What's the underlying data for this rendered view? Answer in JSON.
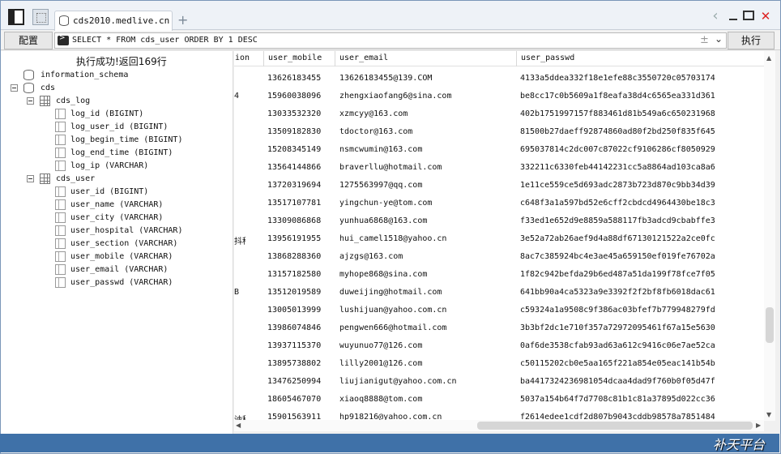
{
  "tab": {
    "title": "cds2010.medlive.cn",
    "new_tab": "+"
  },
  "window": {
    "back": "‹",
    "close": "✕"
  },
  "toolbar": {
    "config_label": "配置",
    "run_label": "执行",
    "sql": "SELECT * FROM cds_user ORDER BY 1 DESC",
    "pm": "±",
    "dropdown": "⌄"
  },
  "status": "执行成功!返回169行",
  "tree": {
    "information_schema": "information_schema",
    "cds": "cds",
    "cds_log": {
      "name": "cds_log",
      "columns": [
        "log_id (BIGINT)",
        "log_user_id (BIGINT)",
        "log_begin_time (BIGINT)",
        "log_end_time (BIGINT)",
        "log_ip (VARCHAR)"
      ]
    },
    "cds_user": {
      "name": "cds_user",
      "columns": [
        "user_id (BIGINT)",
        "user_name (VARCHAR)",
        "user_city (VARCHAR)",
        "user_hospital (VARCHAR)",
        "user_section (VARCHAR)",
        "user_mobile (VARCHAR)",
        "user_email (VARCHAR)",
        "user_passwd (VARCHAR)"
      ]
    }
  },
  "grid": {
    "headers": [
      "ion",
      "user_mobile",
      "user_email",
      "user_passwd"
    ],
    "rows": [
      [
        "",
        "13626183455",
        "13626183455@139.COM",
        "4133a5ddea332f18e1efe88c3550720c05703174"
      ],
      [
        "4",
        "15960038096",
        "zhengxiaofang6@sina.com",
        "be8cc17c0b5609a1f8eafa38d4c6565ea331d361"
      ],
      [
        "",
        "13033532320",
        "xzmcyy@163.com",
        "402b1751997157f883461d81b549a6c650231968"
      ],
      [
        "",
        "13509182830",
        "tdoctor@163.com",
        "81500b27daeff92874860ad80f2bd250f835f645"
      ],
      [
        "",
        "15208345149",
        "nsmcwumin@163.com",
        "695037814c2dc007c87022cf9106286cf8050929"
      ],
      [
        "",
        "13564144866",
        "braverllu@hotmail.com",
        "332211c6330feb44142231cc5a8864ad103ca8a6"
      ],
      [
        "",
        "13720319694",
        "1275563997@qq.com",
        "1e11ce559ce5d693adc2873b723d870c9bb34d39"
      ],
      [
        "",
        "13517107781",
        "yingchun-ye@tom.com",
        "c648f3a1a597bd52e6cff2cbdcd4964430be18c3"
      ],
      [
        "",
        "13309086868",
        "yunhua6868@163.com",
        "f33ed1e652d9e8859a588117fb3adcd9cbabffe3"
      ],
      [
        "抖科",
        "13956191955",
        "hui_camel1518@yahoo.cn",
        "3e52a72ab26aef9d4a88df67130121522a2ce0fc"
      ],
      [
        "",
        "13868288360",
        "ajzgs@163.com",
        "8ac7c385924bc4e3ae45a659150ef019fe76702a"
      ],
      [
        "",
        "13157182580",
        "myhope868@sina.com",
        "1f82c942befda29b6ed487a51da199f78fce7f05"
      ],
      [
        "B",
        "13512019589",
        "duweijing@hotmail.com",
        "641bb90a4ca5323a9e3392f2f2bf8fb6018dac61"
      ],
      [
        "",
        "13005013999",
        "lushijuan@yahoo.com.cn",
        "c59324a1a9508c9f386ac03bfef7b779948279fd"
      ],
      [
        "",
        "13986074846",
        "pengwen666@hotmail.com",
        "3b3bf2dc1e710f357a72972095461f67a15e5630"
      ],
      [
        "",
        "13937115370",
        "wuyunuo77@126.com",
        "0af6de3538cfab93ad63a612c9416c06e7ae52ca"
      ],
      [
        "",
        "13895738802",
        "lilly2001@126.com",
        "c50115202cb0e5aa165f221a854e05eac141b54b"
      ],
      [
        "",
        "13476250994",
        "liujianigut@yahoo.com.cn",
        "ba4417324236981054dcaa4dad9f760b0f05d47f"
      ],
      [
        "",
        "18605467070",
        "xiaoq8888@tom.com",
        "5037a154b64f7d7708c81b1c81a37895d022cc36"
      ],
      [
        "讷科",
        "15901563911",
        "hp918216@yahoo.com.cn",
        "f2614edee1cdf2d807b9043cddb98578a7851484"
      ]
    ]
  },
  "watermark": "补天平台"
}
